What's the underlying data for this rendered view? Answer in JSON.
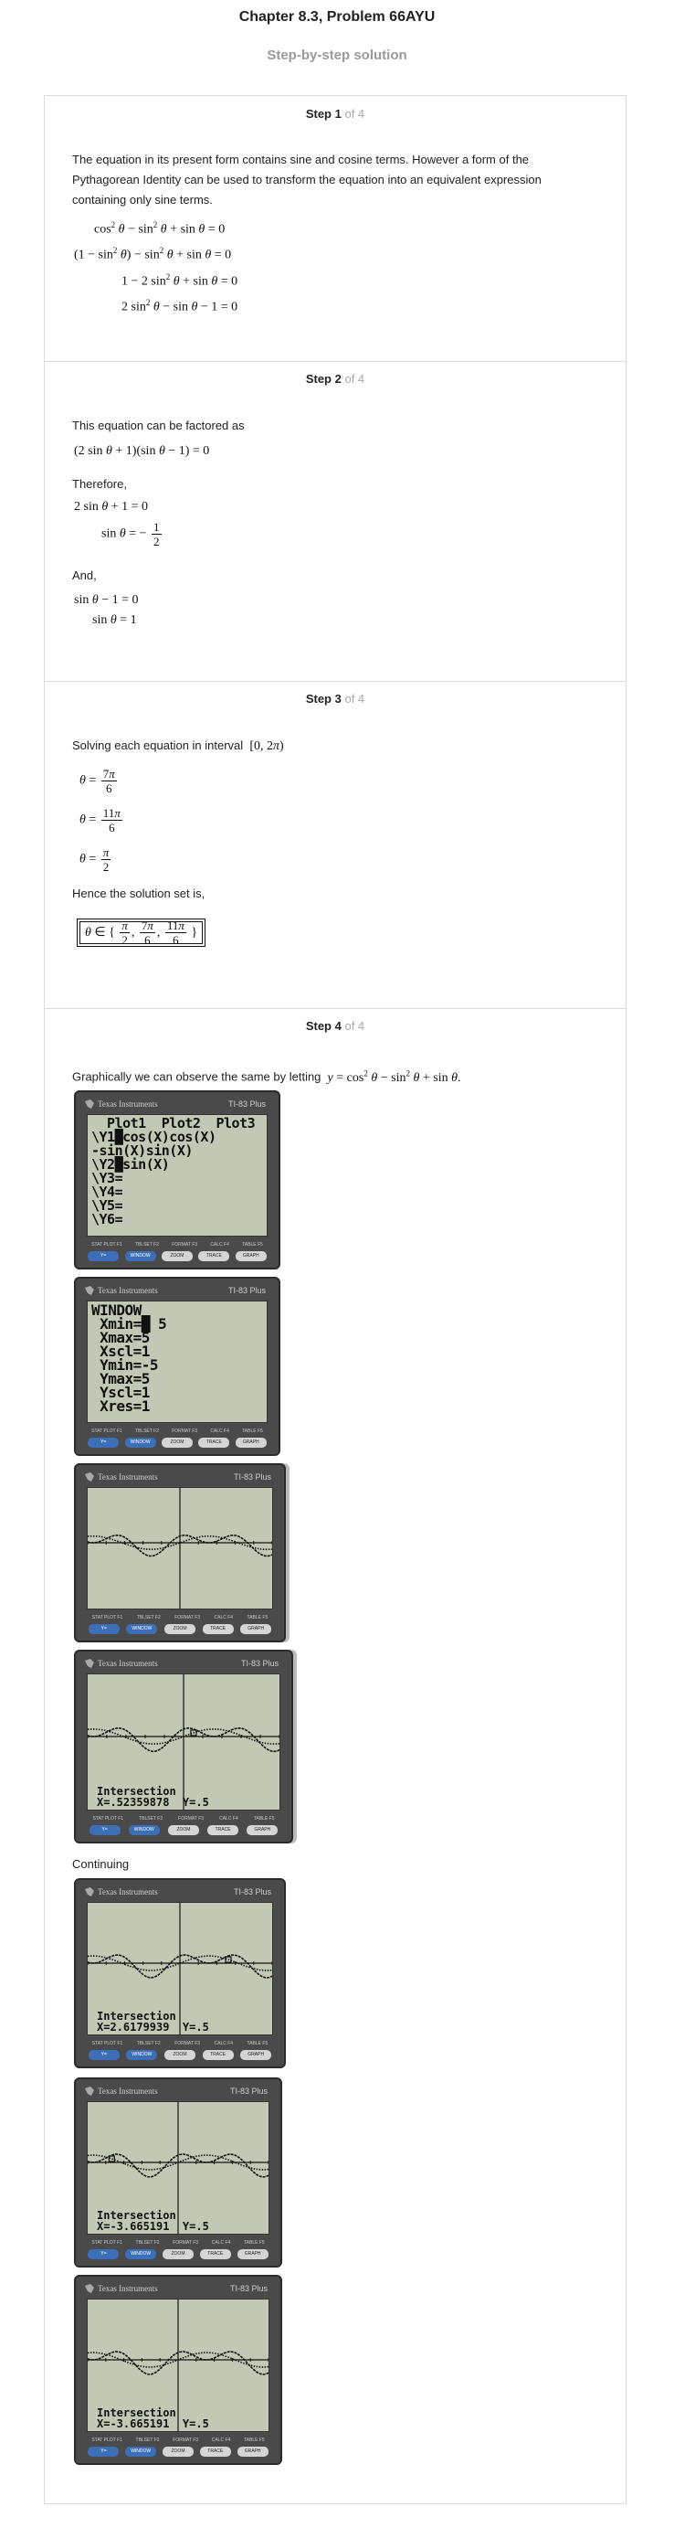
{
  "title": "Chapter 8.3, Problem 66AYU",
  "subtitle": "Step-by-step solution",
  "of_label": "of 4",
  "steps": [
    {
      "label": "Step 1",
      "text": "The equation in its present form contains sine and cosine terms. However a form of the Pythagorean Identity can be used to transform the equation into an equivalent expression containing only sine terms."
    },
    {
      "label": "Step 2",
      "text1": "This equation can be factored as",
      "text2": "Therefore,",
      "text3": "And,"
    },
    {
      "label": "Step 3",
      "text1": "Solving each equation in interval",
      "text2": "Hence the solution set is,"
    },
    {
      "label": "Step 4",
      "text1": "Graphically we can observe the same by letting",
      "text2": "Continuing"
    }
  ],
  "calculator": {
    "brand": "Texas Instruments",
    "model": "TI-83 Plus",
    "func_labels": [
      "STAT PLOT F1",
      "TBLSET F2",
      "FORMAT F3",
      "CALC F4",
      "TABLE F5"
    ],
    "keys": [
      "Y=",
      "WINDOW",
      "ZOOM",
      "TRACE",
      "GRAPH"
    ]
  },
  "screens": {
    "y_editor": "  Plot1  Plot2  Plot3\n\\Y1█cos(X)cos(X)\n-sin(X)sin(X)\n\\Y2█sin(X)\n\\Y3=\n\\Y4=\n\\Y5=\n\\Y6=",
    "window": "WINDOW\n Xmin=█ 5\n Xmax=5\n Xscl=1\n Ymin=-5\n Ymax=5\n Yscl=1\n Xres=1",
    "intersect_label": "Intersection",
    "intersect_1": "X=.52359878  Y=.5",
    "intersect_2": "X=2.6179939  Y=.5",
    "intersect_3": "X=-3.665191  Y=.5",
    "intersect_4": "X=-3.665191  Y=.5"
  }
}
